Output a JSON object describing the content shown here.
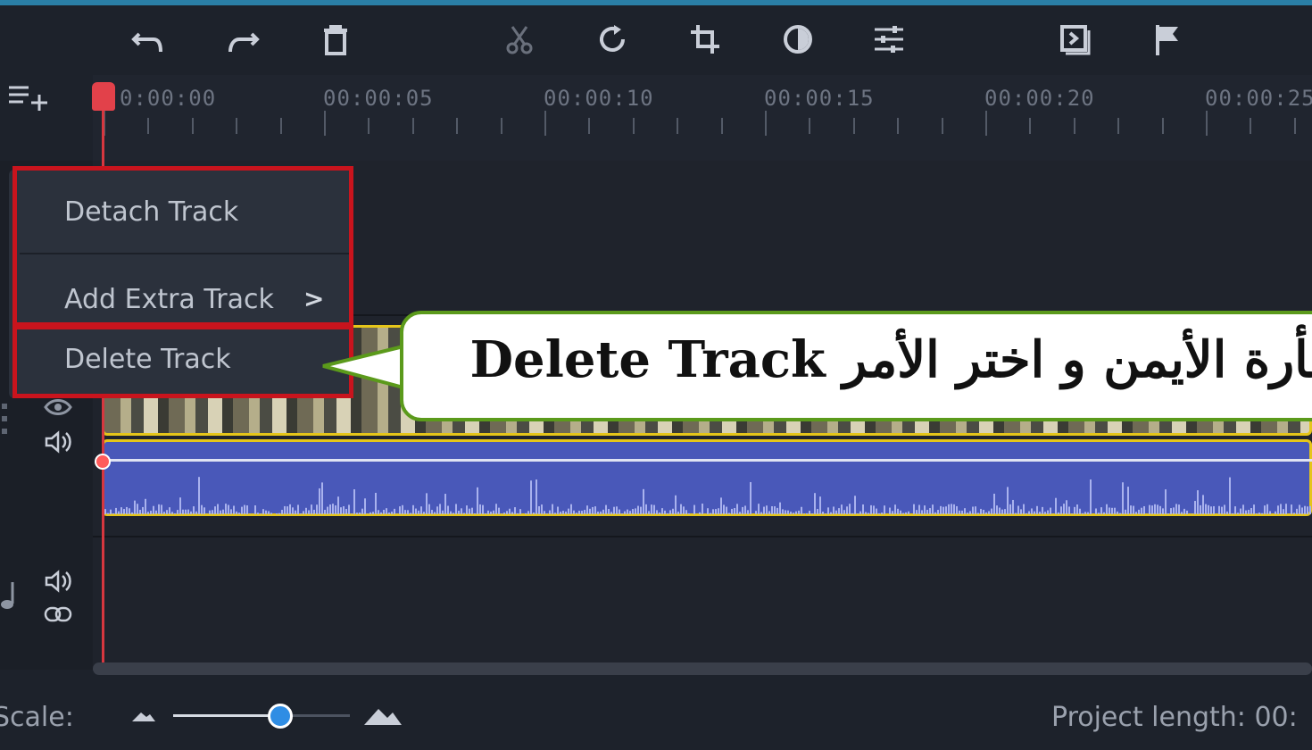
{
  "toolbar": {
    "icons": [
      "undo-icon",
      "redo-icon",
      "delete-icon",
      "cut-icon",
      "rotate-icon",
      "crop-icon",
      "color-adjust-icon",
      "settings-sliders-icon",
      "stabilize-icon",
      "marker-flag-icon"
    ]
  },
  "timeline": {
    "timecodes": [
      "0:00:00",
      "00:00:05",
      "00:00:10",
      "00:00:15",
      "00:00:20",
      "00:00:25"
    ],
    "add_track_icon": "add-track-icon"
  },
  "context_menu": {
    "items": [
      {
        "label": "Detach Track"
      },
      {
        "label": "Add Extra Track",
        "submenu_arrow": ">"
      },
      {
        "label": "Delete Track"
      }
    ]
  },
  "callout": {
    "text": "فأرة الأيمن و اختر الأمر Delete Track"
  },
  "bottom": {
    "scale_label": "Scale:",
    "scale_level": 0.62,
    "project_length": "Project length:  00:"
  },
  "colors": {
    "accent": "#2a7fa6",
    "playhead": "#e2414a",
    "clip_border": "#e5c51a",
    "audio_clip": "#4958b9",
    "highlight": "#c9141d",
    "callout_border": "#5b9a1b"
  }
}
